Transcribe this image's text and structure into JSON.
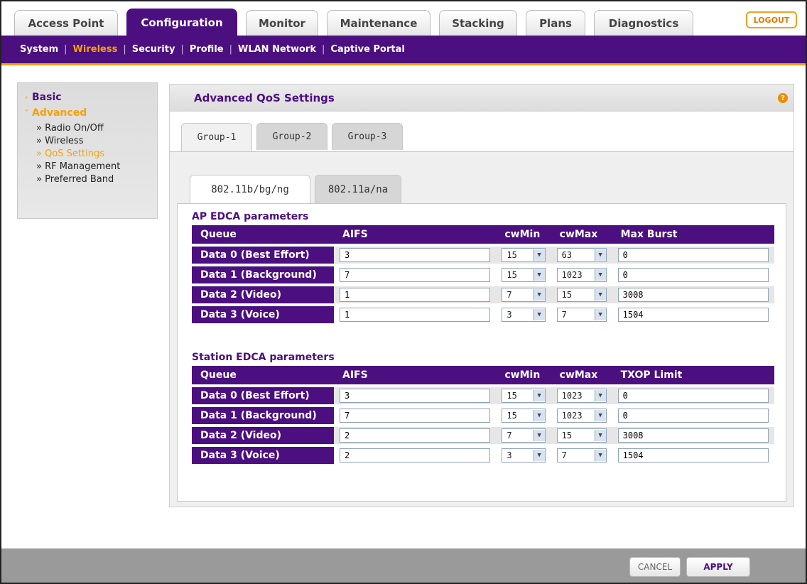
{
  "top_tabs": [
    {
      "label": "Access Point",
      "active": false
    },
    {
      "label": "Configuration",
      "active": true
    },
    {
      "label": "Monitor",
      "active": false
    },
    {
      "label": "Maintenance",
      "active": false
    },
    {
      "label": "Stacking",
      "active": false
    },
    {
      "label": "Plans",
      "active": false
    },
    {
      "label": "Diagnostics",
      "active": false
    }
  ],
  "logout": "LOGOUT",
  "sub_nav": [
    "System",
    "Wireless",
    "Security",
    "Profile",
    "WLAN Network",
    "Captive Portal"
  ],
  "sidebar": {
    "basic": "Basic",
    "advanced": "Advanced",
    "items": [
      "» Radio On/Off",
      "» Wireless",
      "» QoS Settings",
      "» RF Management",
      "» Preferred Band"
    ]
  },
  "panel": {
    "title": "Advanced QoS Settings",
    "help": "?",
    "group_tabs": [
      "Group-1",
      "Group-2",
      "Group-3"
    ],
    "band_tabs": [
      "802.11b/bg/ng",
      "802.11a/na"
    ]
  },
  "ap_edca": {
    "title": "AP EDCA parameters",
    "headers": [
      "Queue",
      "AIFS",
      "cwMin",
      "cwMax",
      "Max Burst"
    ],
    "rows": [
      {
        "queue": "Data 0 (Best Effort)",
        "aifs": "3",
        "cwmin": "15",
        "cwmax": "63",
        "extra": "0"
      },
      {
        "queue": "Data 1 (Background)",
        "aifs": "7",
        "cwmin": "15",
        "cwmax": "1023",
        "extra": "0"
      },
      {
        "queue": "Data 2 (Video)",
        "aifs": "1",
        "cwmin": "7",
        "cwmax": "15",
        "extra": "3008"
      },
      {
        "queue": "Data 3 (Voice)",
        "aifs": "1",
        "cwmin": "3",
        "cwmax": "7",
        "extra": "1504"
      }
    ]
  },
  "sta_edca": {
    "title": "Station EDCA parameters",
    "headers": [
      "Queue",
      "AIFS",
      "cwMin",
      "cwMax",
      "TXOP Limit"
    ],
    "rows": [
      {
        "queue": "Data 0 (Best Effort)",
        "aifs": "3",
        "cwmin": "15",
        "cwmax": "1023",
        "extra": "0"
      },
      {
        "queue": "Data 1 (Background)",
        "aifs": "7",
        "cwmin": "15",
        "cwmax": "1023",
        "extra": "0"
      },
      {
        "queue": "Data 2 (Video)",
        "aifs": "2",
        "cwmin": "7",
        "cwmax": "15",
        "extra": "3008"
      },
      {
        "queue": "Data 3 (Voice)",
        "aifs": "2",
        "cwmin": "3",
        "cwmax": "7",
        "extra": "1504"
      }
    ]
  },
  "footer": {
    "cancel": "CANCEL",
    "apply": "APPLY"
  },
  "colors": {
    "brand": "#4b0f7f",
    "accent": "#f7a100"
  }
}
